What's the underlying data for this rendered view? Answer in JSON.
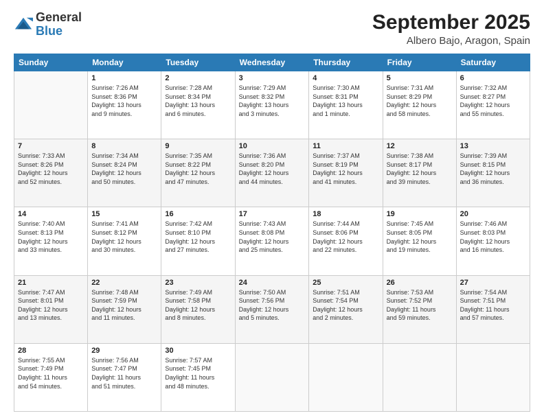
{
  "logo": {
    "general": "General",
    "blue": "Blue"
  },
  "header": {
    "month": "September 2025",
    "location": "Albero Bajo, Aragon, Spain"
  },
  "days_of_week": [
    "Sunday",
    "Monday",
    "Tuesday",
    "Wednesday",
    "Thursday",
    "Friday",
    "Saturday"
  ],
  "weeks": [
    [
      {
        "day": "",
        "info": ""
      },
      {
        "day": "1",
        "info": "Sunrise: 7:26 AM\nSunset: 8:36 PM\nDaylight: 13 hours\nand 9 minutes."
      },
      {
        "day": "2",
        "info": "Sunrise: 7:28 AM\nSunset: 8:34 PM\nDaylight: 13 hours\nand 6 minutes."
      },
      {
        "day": "3",
        "info": "Sunrise: 7:29 AM\nSunset: 8:32 PM\nDaylight: 13 hours\nand 3 minutes."
      },
      {
        "day": "4",
        "info": "Sunrise: 7:30 AM\nSunset: 8:31 PM\nDaylight: 13 hours\nand 1 minute."
      },
      {
        "day": "5",
        "info": "Sunrise: 7:31 AM\nSunset: 8:29 PM\nDaylight: 12 hours\nand 58 minutes."
      },
      {
        "day": "6",
        "info": "Sunrise: 7:32 AM\nSunset: 8:27 PM\nDaylight: 12 hours\nand 55 minutes."
      }
    ],
    [
      {
        "day": "7",
        "info": "Sunrise: 7:33 AM\nSunset: 8:26 PM\nDaylight: 12 hours\nand 52 minutes."
      },
      {
        "day": "8",
        "info": "Sunrise: 7:34 AM\nSunset: 8:24 PM\nDaylight: 12 hours\nand 50 minutes."
      },
      {
        "day": "9",
        "info": "Sunrise: 7:35 AM\nSunset: 8:22 PM\nDaylight: 12 hours\nand 47 minutes."
      },
      {
        "day": "10",
        "info": "Sunrise: 7:36 AM\nSunset: 8:20 PM\nDaylight: 12 hours\nand 44 minutes."
      },
      {
        "day": "11",
        "info": "Sunrise: 7:37 AM\nSunset: 8:19 PM\nDaylight: 12 hours\nand 41 minutes."
      },
      {
        "day": "12",
        "info": "Sunrise: 7:38 AM\nSunset: 8:17 PM\nDaylight: 12 hours\nand 39 minutes."
      },
      {
        "day": "13",
        "info": "Sunrise: 7:39 AM\nSunset: 8:15 PM\nDaylight: 12 hours\nand 36 minutes."
      }
    ],
    [
      {
        "day": "14",
        "info": "Sunrise: 7:40 AM\nSunset: 8:13 PM\nDaylight: 12 hours\nand 33 minutes."
      },
      {
        "day": "15",
        "info": "Sunrise: 7:41 AM\nSunset: 8:12 PM\nDaylight: 12 hours\nand 30 minutes."
      },
      {
        "day": "16",
        "info": "Sunrise: 7:42 AM\nSunset: 8:10 PM\nDaylight: 12 hours\nand 27 minutes."
      },
      {
        "day": "17",
        "info": "Sunrise: 7:43 AM\nSunset: 8:08 PM\nDaylight: 12 hours\nand 25 minutes."
      },
      {
        "day": "18",
        "info": "Sunrise: 7:44 AM\nSunset: 8:06 PM\nDaylight: 12 hours\nand 22 minutes."
      },
      {
        "day": "19",
        "info": "Sunrise: 7:45 AM\nSunset: 8:05 PM\nDaylight: 12 hours\nand 19 minutes."
      },
      {
        "day": "20",
        "info": "Sunrise: 7:46 AM\nSunset: 8:03 PM\nDaylight: 12 hours\nand 16 minutes."
      }
    ],
    [
      {
        "day": "21",
        "info": "Sunrise: 7:47 AM\nSunset: 8:01 PM\nDaylight: 12 hours\nand 13 minutes."
      },
      {
        "day": "22",
        "info": "Sunrise: 7:48 AM\nSunset: 7:59 PM\nDaylight: 12 hours\nand 11 minutes."
      },
      {
        "day": "23",
        "info": "Sunrise: 7:49 AM\nSunset: 7:58 PM\nDaylight: 12 hours\nand 8 minutes."
      },
      {
        "day": "24",
        "info": "Sunrise: 7:50 AM\nSunset: 7:56 PM\nDaylight: 12 hours\nand 5 minutes."
      },
      {
        "day": "25",
        "info": "Sunrise: 7:51 AM\nSunset: 7:54 PM\nDaylight: 12 hours\nand 2 minutes."
      },
      {
        "day": "26",
        "info": "Sunrise: 7:53 AM\nSunset: 7:52 PM\nDaylight: 11 hours\nand 59 minutes."
      },
      {
        "day": "27",
        "info": "Sunrise: 7:54 AM\nSunset: 7:51 PM\nDaylight: 11 hours\nand 57 minutes."
      }
    ],
    [
      {
        "day": "28",
        "info": "Sunrise: 7:55 AM\nSunset: 7:49 PM\nDaylight: 11 hours\nand 54 minutes."
      },
      {
        "day": "29",
        "info": "Sunrise: 7:56 AM\nSunset: 7:47 PM\nDaylight: 11 hours\nand 51 minutes."
      },
      {
        "day": "30",
        "info": "Sunrise: 7:57 AM\nSunset: 7:45 PM\nDaylight: 11 hours\nand 48 minutes."
      },
      {
        "day": "",
        "info": ""
      },
      {
        "day": "",
        "info": ""
      },
      {
        "day": "",
        "info": ""
      },
      {
        "day": "",
        "info": ""
      }
    ]
  ]
}
